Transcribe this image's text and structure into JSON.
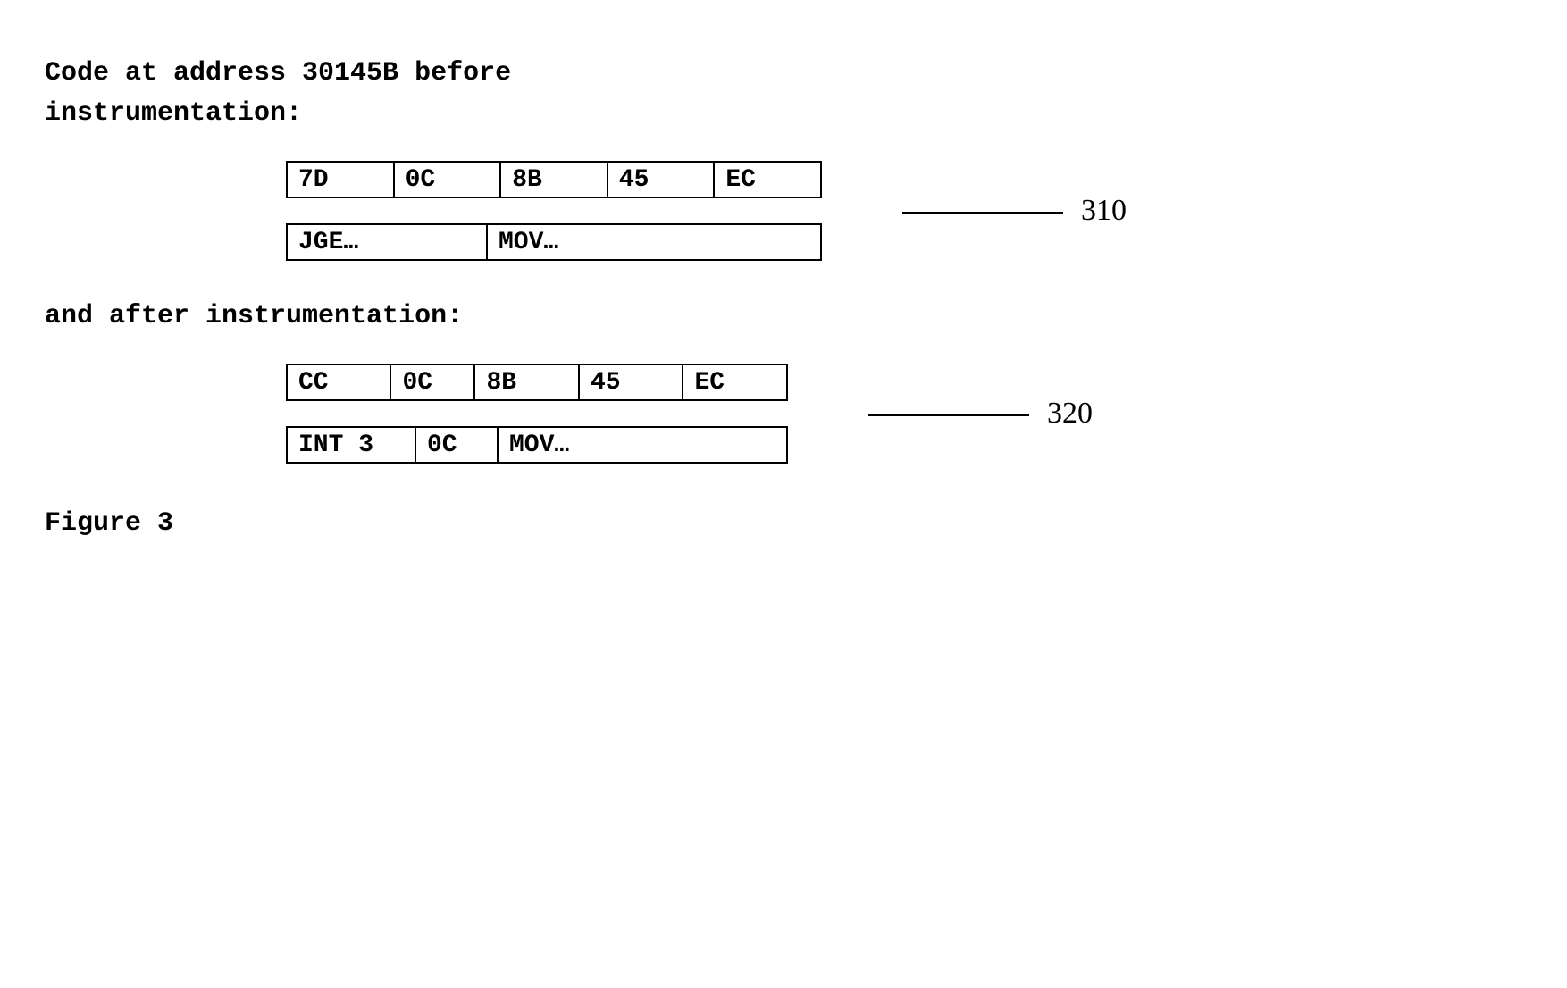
{
  "heading_before_line1": "Code at address 30145B before",
  "heading_before_line2": "instrumentation:",
  "before": {
    "hex": [
      "7D",
      "0C",
      "8B",
      "45",
      "EC"
    ],
    "asm": [
      "JGE…",
      "MOV…"
    ],
    "callout": "310"
  },
  "heading_after": "and after instrumentation:",
  "after": {
    "hex": [
      "CC",
      "0C",
      "8B",
      "45",
      "EC"
    ],
    "asm": [
      "INT 3",
      "0C",
      "MOV…"
    ],
    "callout": "320"
  },
  "figure_caption": "Figure 3"
}
